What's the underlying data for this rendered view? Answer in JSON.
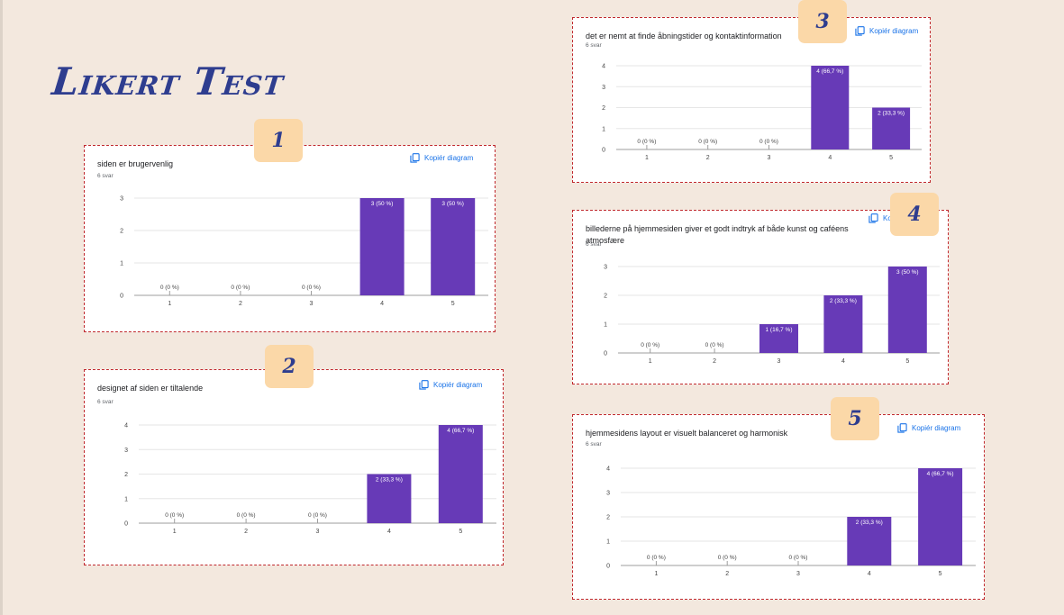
{
  "page": {
    "title": "Likert Test"
  },
  "copy_label": "Kopiér diagram",
  "colors": {
    "bar": "#673ab7",
    "border": "#c0282d",
    "badge": "#fbd8a8",
    "title": "#2e3d8f"
  },
  "chart_data": [
    {
      "type": "bar",
      "badge": "1",
      "title": "siden er brugervenlig",
      "subtitle": "6 svar",
      "categories": [
        "1",
        "2",
        "3",
        "4",
        "5"
      ],
      "values": [
        0,
        0,
        0,
        3,
        3
      ],
      "labels": [
        "0 (0 %)",
        "0 (0 %)",
        "0 (0 %)",
        "3 (50 %)",
        "3 (50 %)"
      ],
      "ylim": [
        0,
        3
      ],
      "yticks": [
        "0",
        "1",
        "2",
        "3"
      ]
    },
    {
      "type": "bar",
      "badge": "2",
      "title": "designet af siden er tiltalende",
      "subtitle": "6 svar",
      "categories": [
        "1",
        "2",
        "3",
        "4",
        "5"
      ],
      "values": [
        0,
        0,
        0,
        2,
        4
      ],
      "labels": [
        "0 (0 %)",
        "0 (0 %)",
        "0 (0 %)",
        "2 (33,3 %)",
        "4 (66,7 %)"
      ],
      "ylim": [
        0,
        4
      ],
      "yticks": [
        "0",
        "1",
        "2",
        "3",
        "4"
      ]
    },
    {
      "type": "bar",
      "badge": "3",
      "title": "det er nemt at finde åbningstider og kontaktinformation",
      "subtitle": "6 svar",
      "categories": [
        "1",
        "2",
        "3",
        "4",
        "5"
      ],
      "values": [
        0,
        0,
        0,
        4,
        2
      ],
      "labels": [
        "0 (0 %)",
        "0 (0 %)",
        "0 (0 %)",
        "4 (66,7 %)",
        "2 (33,3 %)"
      ],
      "ylim": [
        0,
        4
      ],
      "yticks": [
        "0",
        "1",
        "2",
        "3",
        "4"
      ]
    },
    {
      "type": "bar",
      "badge": "4",
      "title": "billederne på hjemmesiden giver et godt indtryk af både kunst og caféens atmosfære",
      "subtitle": "6 svar",
      "categories": [
        "1",
        "2",
        "3",
        "4",
        "5"
      ],
      "values": [
        0,
        0,
        1,
        2,
        3
      ],
      "labels": [
        "0 (0 %)",
        "0 (0 %)",
        "1 (16,7 %)",
        "2 (33,3 %)",
        "3 (50 %)"
      ],
      "ylim": [
        0,
        3
      ],
      "yticks": [
        "0",
        "1",
        "2",
        "3"
      ]
    },
    {
      "type": "bar",
      "badge": "5",
      "title": "hjemmesidens layout er visuelt balanceret og harmonisk",
      "subtitle": "6 svar",
      "categories": [
        "1",
        "2",
        "3",
        "4",
        "5"
      ],
      "values": [
        0,
        0,
        0,
        2,
        4
      ],
      "labels": [
        "0 (0 %)",
        "0 (0 %)",
        "0 (0 %)",
        "2 (33,3 %)",
        "4 (66,7 %)"
      ],
      "ylim": [
        0,
        4
      ],
      "yticks": [
        "0",
        "1",
        "2",
        "3",
        "4"
      ]
    }
  ]
}
